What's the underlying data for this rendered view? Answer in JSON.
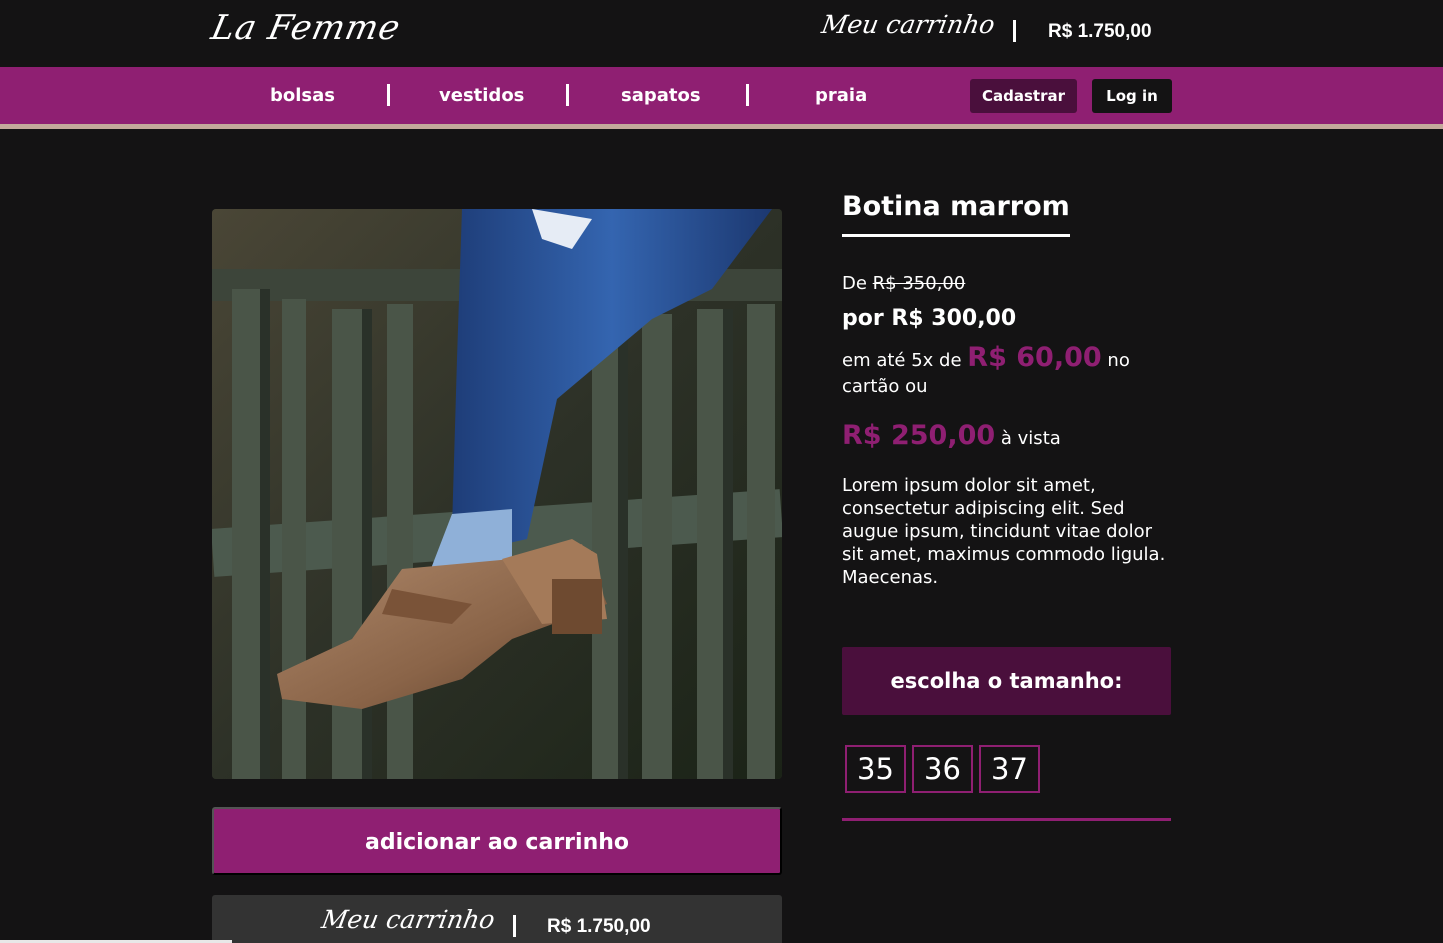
{
  "header": {
    "logo": "La Femme",
    "cart_label": "Meu carrinho",
    "cart_total": "R$ 1.750,00"
  },
  "nav": {
    "items": [
      "bolsas",
      "vestidos",
      "sapatos",
      "praia"
    ],
    "signup": "Cadastrar",
    "login": "Log in"
  },
  "product": {
    "name": "Botina marrom",
    "old_prefix": "De",
    "old_price": "R$ 350,00",
    "new_price": "por R$ 300,00",
    "installments_prefix": "em até 5x de",
    "installment_value": "R$ 60,00",
    "installments_suffix": "no cartão ou",
    "cash_value": "R$ 250,00",
    "cash_suffix": "à vista",
    "description": "Lorem ipsum dolor sit amet, consectetur adipiscing elit. Sed augue ipsum, tincidunt vitae dolor sit amet, maximus commodo ligula. Maecenas.",
    "size_title": "escolha o tamanho:",
    "sizes": [
      "35",
      "36",
      "37"
    ],
    "add_to_cart": "adicionar ao carrinho"
  },
  "footer_cart": {
    "label": "Meu carrinho",
    "total": "R$ 1.750,00"
  },
  "colors": {
    "accent": "#8f1f72",
    "accent_dark": "#4a0f3c",
    "background": "#141314"
  }
}
